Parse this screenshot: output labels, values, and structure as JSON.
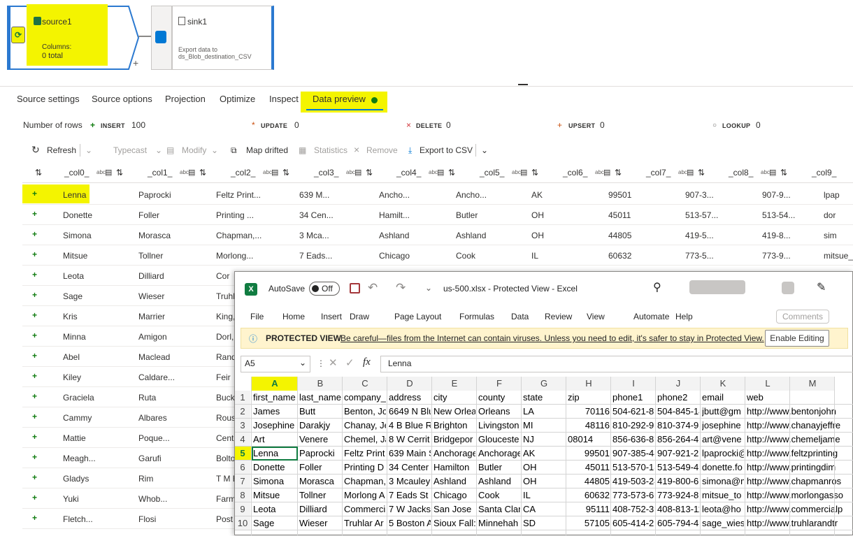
{
  "pipeline": {
    "source": {
      "name": "source1",
      "columns_label": "Columns:",
      "total": "0 total"
    },
    "plus": "+",
    "sink": {
      "name": "sink1",
      "description": "Export data to ds_Blob_destination_CSV"
    }
  },
  "tabs": [
    "Source settings",
    "Source options",
    "Projection",
    "Optimize",
    "Inspect",
    "Data preview"
  ],
  "stats": {
    "rows_label": "Number of rows",
    "insert_label": "INSERT",
    "insert_value": "100",
    "update_label": "UPDATE",
    "update_value": "0",
    "delete_label": "DELETE",
    "delete_value": "0",
    "upsert_label": "UPSERT",
    "upsert_value": "0",
    "lookup_label": "LOOKUP",
    "lookup_value": "0"
  },
  "toolbar": {
    "refresh": "Refresh",
    "typecast": "Typecast",
    "modify": "Modify",
    "map_drifted": "Map drifted",
    "statistics": "Statistics",
    "remove": "Remove",
    "export": "Export to CSV"
  },
  "columns": [
    "_col0_",
    "_col1_",
    "_col2_",
    "_col3_",
    "_col4_",
    "_col5_",
    "_col6_",
    "_col7_",
    "_col8_",
    "_col9_"
  ],
  "preview_rows": [
    [
      "Lenna",
      "Paprocki",
      "Feltz Print...",
      "639 M...",
      "Ancho...",
      "Ancho...",
      "AK",
      "99501",
      "907-3...",
      "907-9...",
      "lpap"
    ],
    [
      "Donette",
      "Foller",
      "Printing ...",
      "34 Cen...",
      "Hamilt...",
      "Butler",
      "OH",
      "45011",
      "513-57...",
      "513-54...",
      "dor"
    ],
    [
      "Simona",
      "Morasca",
      "Chapman,...",
      "3 Mca...",
      "Ashland",
      "Ashland",
      "OH",
      "44805",
      "419-5...",
      "419-8...",
      "sim"
    ],
    [
      "Mitsue",
      "Tollner",
      "Morlong...",
      "7 Eads...",
      "Chicago",
      "Cook",
      "IL",
      "60632",
      "773-5...",
      "773-9...",
      "mitsue_t"
    ],
    [
      "Leota",
      "Dilliard",
      "Cor",
      "",
      "",
      "",
      "",
      "",
      "",
      "",
      ""
    ],
    [
      "Sage",
      "Wieser",
      "Truhl",
      "",
      "",
      "",
      "",
      "",
      "",
      "",
      ""
    ],
    [
      "Kris",
      "Marrier",
      "King,",
      "",
      "",
      "",
      "",
      "",
      "",
      "",
      ""
    ],
    [
      "Minna",
      "Amigon",
      "Dorl,",
      "",
      "",
      "",
      "",
      "",
      "",
      "",
      ""
    ],
    [
      "Abel",
      "Maclead",
      "Rand",
      "",
      "",
      "",
      "",
      "",
      "",
      "",
      ""
    ],
    [
      "Kiley",
      "Caldare...",
      "Feir",
      "",
      "",
      "",
      "",
      "",
      "",
      "",
      ""
    ],
    [
      "Graciela",
      "Ruta",
      "Buckl",
      "",
      "",
      "",
      "",
      "",
      "",
      "",
      ""
    ],
    [
      "Cammy",
      "Albares",
      "Rous",
      "",
      "",
      "",
      "",
      "",
      "",
      "",
      ""
    ],
    [
      "Mattie",
      "Poque...",
      "Centr",
      "",
      "",
      "",
      "",
      "",
      "",
      "",
      ""
    ],
    [
      "Meagh...",
      "Garufi",
      "Bolto",
      "",
      "",
      "",
      "",
      "",
      "",
      "",
      ""
    ],
    [
      "Gladys",
      "Rim",
      "T M B",
      "",
      "",
      "",
      "",
      "",
      "",
      "",
      ""
    ],
    [
      "Yuki",
      "Whob...",
      "Farme",
      "",
      "",
      "",
      "",
      "",
      "",
      "",
      ""
    ],
    [
      "Fletch...",
      "Flosi",
      "Post B",
      "",
      "",
      "",
      "",
      "",
      "",
      "",
      ""
    ]
  ],
  "excel": {
    "autosave": "AutoSave",
    "toggle": "Off",
    "title": "us-500.xlsx  -  Protected View  -  Excel",
    "menu": [
      "File",
      "Home",
      "Insert",
      "Draw",
      "Page Layout",
      "Formulas",
      "Data",
      "Review",
      "View",
      "Automate",
      "Help"
    ],
    "comments": "Comments",
    "pv_label": "PROTECTED VIEW",
    "pv_msg": "Be careful—files from the Internet can contain viruses. Unless you need to edit, it's safer to stay in Protected View.",
    "enable": "Enable Editing",
    "namebox": "A5",
    "formula": "Lenna",
    "fx": "fx",
    "col_letters": [
      "A",
      "B",
      "C",
      "D",
      "E",
      "F",
      "G",
      "H",
      "I",
      "J",
      "K",
      "L",
      "M"
    ],
    "rows": [
      [
        "1",
        "first_name",
        "last_name",
        "company_",
        "address",
        "city",
        "county",
        "state",
        "zip",
        "phone1",
        "phone2",
        "email",
        "web"
      ],
      [
        "2",
        "James",
        "Butt",
        "Benton, Jo",
        "6649 N Blu",
        "New Orlea",
        "Orleans",
        "LA",
        "70116",
        "504-621-89",
        "504-845-14",
        "jbutt@gm",
        "http://www.bentonjohn"
      ],
      [
        "3",
        "Josephine",
        "Darakjy",
        "Chanay, Je",
        "4 B Blue R",
        "Brighton",
        "Livingston",
        "MI",
        "48116",
        "810-292-93",
        "810-374-93",
        "josephine",
        "http://www.chanayjeffre"
      ],
      [
        "4",
        "Art",
        "Venere",
        "Chemel, Ja",
        "8 W Cerrit",
        "Bridgepor",
        "Glouceste",
        "NJ",
        "08014",
        "856-636-87",
        "856-264-41",
        "art@vene",
        "http://www.chemeljame"
      ],
      [
        "5",
        "Lenna",
        "Paprocki",
        "Feltz Print",
        "639 Main S",
        "Anchorage",
        "Anchorage",
        "AK",
        "99501",
        "907-385-44",
        "907-921-26",
        "lpaprocki@",
        "http://www.feltzprinting"
      ],
      [
        "6",
        "Donette",
        "Foller",
        "Printing D",
        "34 Center",
        "Hamilton",
        "Butler",
        "OH",
        "45011",
        "513-570-18",
        "513-549-45",
        "donette.fo",
        "http://www.printingdim"
      ],
      [
        "7",
        "Simona",
        "Morasca",
        "Chapman,",
        "3 Mcauley",
        "Ashland",
        "Ashland",
        "OH",
        "44805",
        "419-503-24",
        "419-800-61",
        "simona@m",
        "http://www.chapmanros"
      ],
      [
        "8",
        "Mitsue",
        "Tollner",
        "Morlong A",
        "7 Eads St",
        "Chicago",
        "Cook",
        "IL",
        "60632",
        "773-573-69",
        "773-924-89",
        "mitsue_to",
        "http://www.morlongasso"
      ],
      [
        "9",
        "Leota",
        "Dilliard",
        "Commerci",
        "7 W Jackso",
        "San Jose",
        "Santa Clar",
        "CA",
        "95111",
        "408-752-35",
        "408-813-11",
        "leota@ho",
        "http://www.commercialp"
      ],
      [
        "10",
        "Sage",
        "Wieser",
        "Truhlar Ar",
        "5 Boston A",
        "Sioux Fall:",
        "Minnehah",
        "SD",
        "57105",
        "605-414-21",
        "605-794-48",
        "sage_wies",
        "http://www.truhlarandtr"
      ]
    ]
  },
  "colors": {
    "highlight": "#f4f400",
    "accent": "#0078d4",
    "excel_green": "#107c41"
  }
}
